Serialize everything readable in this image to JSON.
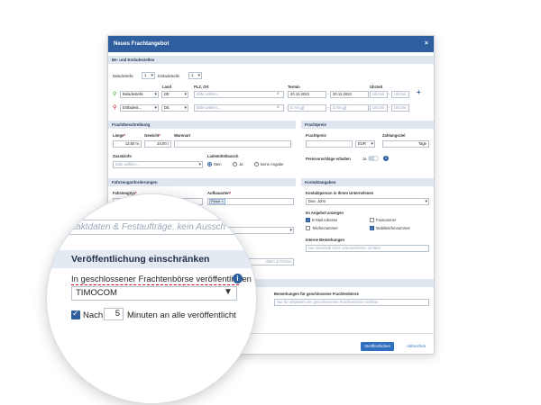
{
  "dialog": {
    "title": "Neues Frachtangebot",
    "close": "×"
  },
  "sections": {
    "be_entlade": "Be- und Entladestellen",
    "fracht": "Frachtbeschreibung",
    "preis": "Frachtpreis",
    "fahrzeug": "Fahrzeuganforderungen",
    "kontakt": "Kontaktangaben"
  },
  "stops": {
    "beladestelle_label": "Beladestelle",
    "beladestelle_count": "1",
    "entladestelle_label": "Entladestelle",
    "entladestelle_count": "1",
    "col_land": "Land",
    "col_plz": "PLZ, Ort",
    "col_termin": "Termin",
    "col_uhrzeit": "Uhrzeit",
    "row1": {
      "type": "Beladestelle",
      "land": "DE",
      "place_ph": "Bitte wählen...",
      "date_from": "20.12.2022",
      "date_to": "20.12.2022",
      "time_from_ph": "Uhrzeit",
      "time_to_ph": "Uhrzeit"
    },
    "row2": {
      "type": "Entladest...",
      "land": "DE",
      "place_ph": "Bitte wählen...",
      "date_from_ph": "tt.mm.jjjj",
      "date_to_ph": "tt.mm.jjjj",
      "time_from_ph": "Uhrzeit",
      "time_to_ph": "Uhrzeit"
    },
    "dash": "-"
  },
  "fracht": {
    "laenge_label": "Länge",
    "laenge_value": "13,60",
    "laenge_unit": "m",
    "gewicht_label": "Gewicht",
    "gewicht_value": "24,00",
    "gewicht_unit": "t",
    "warenart_label": "Warenart",
    "zusatzinfo_label": "Zusatzinfo",
    "zusatzinfo_ph": "Bitte wählen...",
    "lademittel_label": "Lademitteltausch",
    "opt_nein": "Nein",
    "opt_ja": "Ja",
    "opt_keine": "keine Angabe"
  },
  "preis": {
    "frachtpreis_label": "Frachtpreis",
    "currency": "EUR",
    "zahlungsziel_label": "Zahlungsziel",
    "zahlungsziel_unit": "Tage",
    "vorschlaege_label": "Preisvorschläge erhalten",
    "toggle_label": "Ja"
  },
  "fahrzeug": {
    "typ_label": "Fahrzeugtyp",
    "typ_value": "Ge",
    "aufbau_label": "Aufbauarten",
    "aufbau_tag": "Plane",
    "kontaktdaten_ph": "re Kontaktdaten & Festaufträge, kein Aussch",
    "bemerkungen_ph": "daten & Firmen"
  },
  "kontakt": {
    "person_label": "Kontaktperson in Ihrem Unternehmen",
    "person_value": "Doe, John",
    "anzeigen_label": "Im Angebot anzeigen",
    "email": "E-Mail Adresse",
    "fax": "Faxnummer",
    "telefon": "Telefonnummer",
    "mobil": "Mobiltelefonnummer",
    "intern_label": "Interne Bemerkungen",
    "intern_ph": "Nur innerhalb Ihres Unternehmens sichtbar",
    "geschlossen_label": "Bemerkungen für geschlossene Frachtenbörse",
    "geschlossen_ph": "Nur für Mitglieder der geschlossenen Frachtenbörse sichtbar"
  },
  "footer": {
    "publish": "Veröffentlichen",
    "cancel": "Abbrechen"
  },
  "lens": {
    "kontakt_ph": "re Kontaktdaten & Festaufträge, kein Aussch",
    "heading": "Veröffentlichung einschränken",
    "closed_label": "In geschlossener Frachtenbörse veröffentlichen",
    "closed_value": "TIMOCOM",
    "nach": "Nach",
    "minutes": "5",
    "rest": "Minuten an alle veröffentlicht",
    "info": "i"
  }
}
